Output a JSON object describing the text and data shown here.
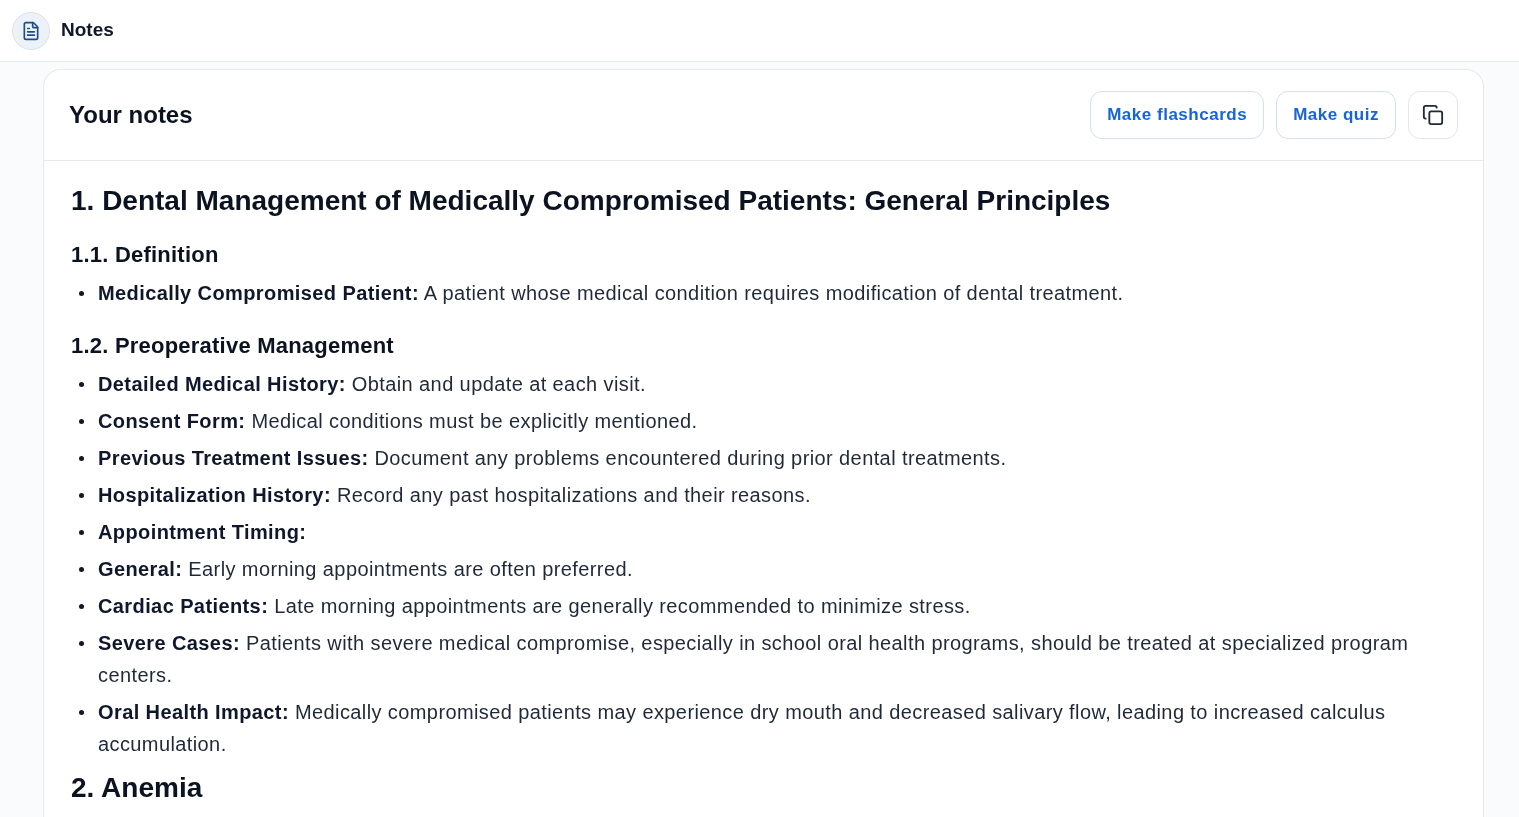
{
  "header": {
    "title": "Notes"
  },
  "notes_card": {
    "title": "Your notes",
    "actions": [
      "Make flashcards",
      "Make quiz"
    ],
    "sections": [
      {
        "heading": "1. Dental Management of Medically Compromised Patients: General Principles",
        "subsections": [
          {
            "heading": "1.1. Definition",
            "items": [
              {
                "label": "Medically Compromised Patient:",
                "text": "A patient whose medical condition requires modification of dental treatment."
              }
            ]
          },
          {
            "heading": "1.2. Preoperative Management",
            "items": [
              {
                "label": "Detailed Medical History:",
                "text": "Obtain and update at each visit."
              },
              {
                "label": "Consent Form:",
                "text": "Medical conditions must be explicitly mentioned."
              },
              {
                "label": "Previous Treatment Issues:",
                "text": "Document any problems encountered during prior dental treatments."
              },
              {
                "label": "Hospitalization History:",
                "text": "Record any past hospitalizations and their reasons."
              },
              {
                "label": "Appointment Timing:"
              },
              {
                "label": "General:",
                "text": "Early morning appointments are often preferred."
              },
              {
                "label": "Cardiac Patients:",
                "text": "Late morning appointments are generally recommended to minimize stress."
              },
              {
                "label": "Severe Cases:",
                "text": "Patients with severe medical compromise, especially in school oral health programs, should be treated at specialized program centers."
              },
              {
                "label": "Oral Health Impact:",
                "text": "Medically compromised patients may experience dry mouth and decreased salivary flow, leading to increased calculus accumulation."
              }
            ]
          }
        ]
      },
      {
        "heading": "2. Anemia"
      }
    ]
  }
}
